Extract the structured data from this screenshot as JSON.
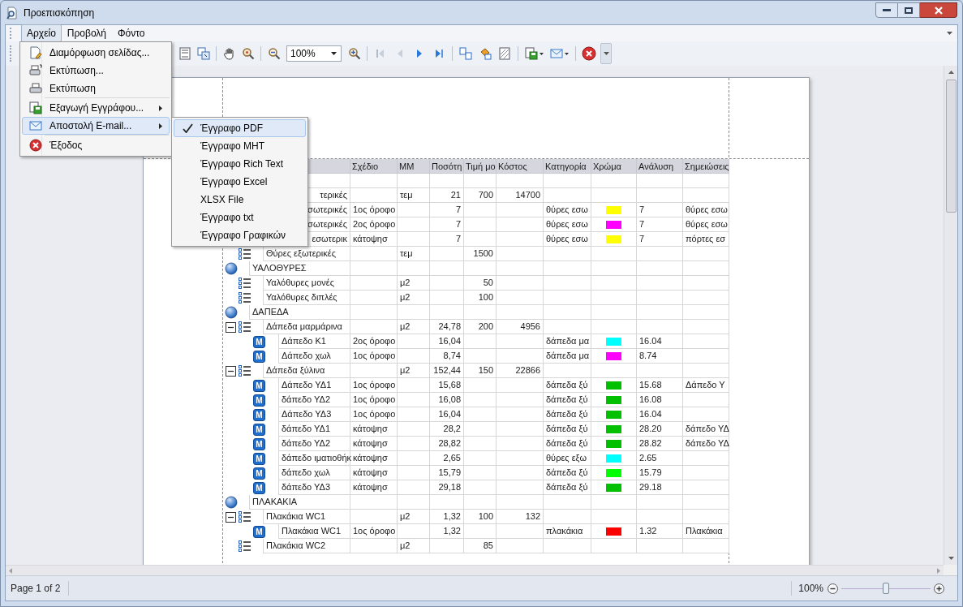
{
  "window": {
    "title": "Προεπισκόπηση"
  },
  "menu_bar": [
    {
      "label": "Αρχείο",
      "selected": true
    },
    {
      "label": "Προβολή",
      "selected": false
    },
    {
      "label": "Φόντο",
      "selected": false
    }
  ],
  "toolbar": {
    "zoom_value": "100%"
  },
  "file_menu": [
    {
      "label": "Διαμόρφωση σελίδας...",
      "submenu": false,
      "selected": false,
      "separator_before": false
    },
    {
      "label": "Εκτύπωση...",
      "submenu": false,
      "selected": false,
      "separator_before": false
    },
    {
      "label": "Εκτύπωση",
      "submenu": false,
      "selected": false,
      "separator_before": false
    },
    {
      "label": "Εξαγωγή Εγγράφου...",
      "submenu": true,
      "selected": false,
      "separator_before": true
    },
    {
      "label": "Αποστολή E-mail...",
      "submenu": true,
      "selected": true,
      "separator_before": false
    },
    {
      "label": "Έξοδος",
      "submenu": false,
      "selected": false,
      "separator_before": true
    }
  ],
  "email_submenu": [
    {
      "label": "Έγγραφο PDF",
      "checked": true,
      "selected": true
    },
    {
      "label": "Έγγραφο MHT",
      "checked": false,
      "selected": false
    },
    {
      "label": "Έγγραφο Rich Text",
      "checked": false,
      "selected": false
    },
    {
      "label": "Έγγραφο Excel",
      "checked": false,
      "selected": false
    },
    {
      "label": "XLSX File",
      "checked": false,
      "selected": false
    },
    {
      "label": "Έγγραφο txt",
      "checked": false,
      "selected": false
    },
    {
      "label": "Έγγραφο Γραφικών",
      "checked": false,
      "selected": false
    }
  ],
  "table": {
    "columns": [
      "Σχέδιο",
      "ΜΜ",
      "Ποσότη",
      "Τιμή μο",
      "Κόστος",
      "Κατηγορία",
      "Χρώμα",
      "Ανάλυση",
      "Σημειώσεις"
    ],
    "rows": [
      {
        "kind": "blank"
      },
      {
        "kind": "covered",
        "name": "τερικές",
        "unit": "τεμ",
        "qty": "21",
        "price": "700",
        "cost": "14700"
      },
      {
        "kind": "covered",
        "name": "σωτερικές",
        "plan": "1ος όροφο",
        "qty": "7",
        "category": "θύρες εσω",
        "color": "#ffff00",
        "analysis": "7",
        "notes": "θύρες εσω"
      },
      {
        "kind": "covered",
        "name": "σωτερικές",
        "plan": "2ος όροφο",
        "qty": "7",
        "category": "θύρες εσω",
        "color": "#ff00ff",
        "analysis": "7",
        "notes": "θύρες εσω"
      },
      {
        "kind": "covered",
        "name": "εσωτερικ",
        "plan": "κάτοψησ",
        "qty": "7",
        "category": "θύρες εσω",
        "color": "#ffff00",
        "analysis": "7",
        "notes": "πόρτες εσ"
      },
      {
        "kind": "item",
        "expanded": false,
        "name": "Θύρες εξωτερικές",
        "unit": "τεμ",
        "price": "1500"
      },
      {
        "kind": "group",
        "name": "ΥΑΛΟΘΥΡΕΣ"
      },
      {
        "kind": "item",
        "expanded": false,
        "name": "Υαλόθυρες μονές",
        "unit": "μ2",
        "price": "50"
      },
      {
        "kind": "item",
        "expanded": false,
        "name": "Υαλόθυρες διπλές",
        "unit": "μ2",
        "price": "100"
      },
      {
        "kind": "group",
        "name": "ΔΑΠΕΔΑ"
      },
      {
        "kind": "item",
        "expanded": true,
        "name": "Δάπεδα μαρμάρινα",
        "unit": "μ2",
        "qty": "24,78",
        "price": "200",
        "cost": "4956"
      },
      {
        "kind": "measure",
        "badge": "M",
        "name": "Δάπεδο Κ1",
        "plan": "2ος όροφο",
        "qty": "16,04",
        "category": "δάπεδα μα",
        "color": "#00ffff",
        "analysis": "16.04"
      },
      {
        "kind": "measure",
        "badge": "M",
        "name": "Δάπεδο χωλ",
        "plan": "1ος όροφο",
        "qty": "8,74",
        "category": "δάπεδα μα",
        "color": "#ff00ff",
        "analysis": "8.74"
      },
      {
        "kind": "item",
        "expanded": true,
        "name": "Δάπεδα ξύλινα",
        "unit": "μ2",
        "qty": "152,44",
        "price": "150",
        "cost": "22866"
      },
      {
        "kind": "measure",
        "badge": "M",
        "name": "Δάπεδο ΥΔ1",
        "plan": "1ος όροφο",
        "qty": "15,68",
        "category": "δάπεδα ξύ",
        "color": "#00c000",
        "analysis": "15.68",
        "notes": "Δάπεδο Υ"
      },
      {
        "kind": "measure",
        "badge": "M",
        "name": "δάπεδο ΥΔ2",
        "plan": "1ος όροφο",
        "qty": "16,08",
        "category": "δάπεδα ξύ",
        "color": "#00c000",
        "analysis": "16.08"
      },
      {
        "kind": "measure",
        "badge": "M",
        "name": "Δάπεδο ΥΔ3",
        "plan": "1ος όροφο",
        "qty": "16,04",
        "category": "δάπεδα ξύ",
        "color": "#00c000",
        "analysis": "16.04"
      },
      {
        "kind": "measure",
        "badge": "M",
        "name": "δάπεδο ΥΔ1",
        "plan": "κάτοψησ",
        "qty": "28,2",
        "category": "δάπεδα ξύ",
        "color": "#00c000",
        "analysis": "28.20",
        "notes": "δάπεδο ΥΔ"
      },
      {
        "kind": "measure",
        "badge": "M",
        "name": "δάπεδο ΥΔ2",
        "plan": "κάτοψησ",
        "qty": "28,82",
        "category": "δάπεδα ξύ",
        "color": "#00c000",
        "analysis": "28.82",
        "notes": "δάπεδο ΥΔ"
      },
      {
        "kind": "measure",
        "badge": "M",
        "name": "δάπεδο ιματιοθήκ",
        "plan": "κάτοψησ",
        "qty": "2,65",
        "category": "θύρες εξω",
        "color": "#00ffff",
        "analysis": "2.65"
      },
      {
        "kind": "measure",
        "badge": "M",
        "name": "δάπεδο χωλ",
        "plan": "κάτοψησ",
        "qty": "15,79",
        "category": "δάπεδα ξύ",
        "color": "#00ff00",
        "analysis": "15.79"
      },
      {
        "kind": "measure",
        "badge": "M",
        "name": "δάπεδο ΥΔ3",
        "plan": "κάτοψησ",
        "qty": "29,18",
        "category": "δάπεδα ξύ",
        "color": "#00c000",
        "analysis": "29.18"
      },
      {
        "kind": "group",
        "name": "ΠΛΑΚΑΚΙΑ"
      },
      {
        "kind": "item",
        "expanded": true,
        "name": "Πλακάκια WC1",
        "unit": "μ2",
        "qty": "1,32",
        "price": "100",
        "cost": "132"
      },
      {
        "kind": "measure",
        "badge": "M",
        "name": "Πλακάκια WC1",
        "plan": "1ος όροφο",
        "qty": "1,32",
        "category": "πλακάκια",
        "color": "#ff0000",
        "analysis": "1.32",
        "notes": "Πλακάκια"
      },
      {
        "kind": "item",
        "expanded": false,
        "name": "Πλακάκια WC2",
        "unit": "μ2",
        "price": "85"
      }
    ]
  },
  "status_bar": {
    "page": "Page 1 of 2",
    "zoom_value": "100%",
    "zoom_slider": {
      "level": 0.5
    }
  }
}
